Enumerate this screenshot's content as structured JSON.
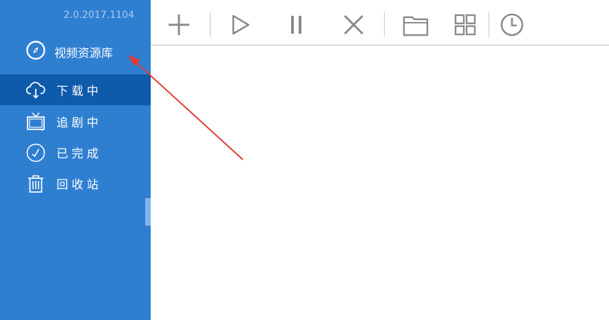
{
  "app": {
    "version": "2.0.2017.1104"
  },
  "sidebar": {
    "library_link": {
      "label": "视频资源库",
      "icon": "compass-icon"
    },
    "items": [
      {
        "label": "下载中",
        "icon": "cloud-download-icon",
        "active": true
      },
      {
        "label": "追剧中",
        "icon": "tv-icon",
        "active": false
      },
      {
        "label": "已完成",
        "icon": "check-circle-icon",
        "active": false
      },
      {
        "label": "回收站",
        "icon": "trash-icon",
        "active": false
      }
    ]
  },
  "toolbar": {
    "buttons": [
      {
        "icon": "plus-icon"
      },
      {
        "icon": "play-icon"
      },
      {
        "icon": "pause-icon"
      },
      {
        "icon": "close-icon"
      },
      {
        "icon": "folder-icon"
      },
      {
        "icon": "grid-icon"
      },
      {
        "icon": "clock-icon"
      }
    ]
  },
  "colors": {
    "sidebar_bg": "#2f7fd1",
    "sidebar_active_bg": "#0f5bab",
    "version_text": "#a8cbf0",
    "toolbar_icon": "#8a8a8a",
    "annotation_arrow": "#e53935"
  }
}
